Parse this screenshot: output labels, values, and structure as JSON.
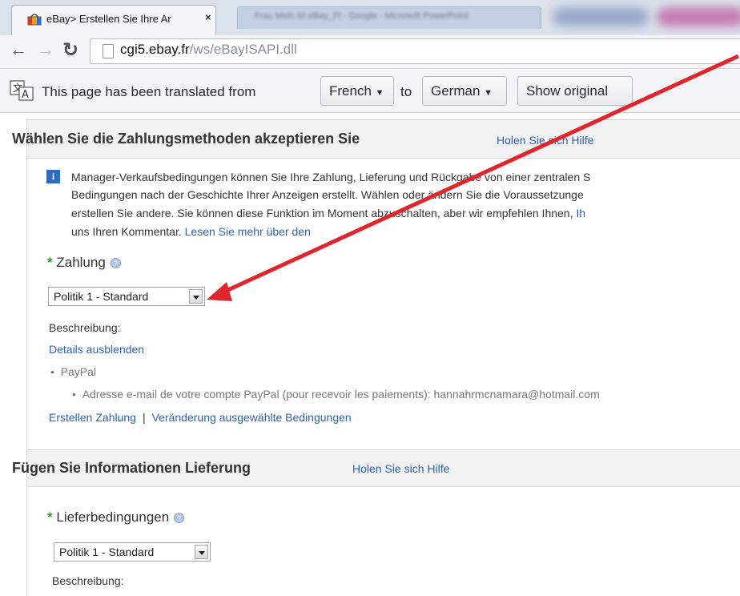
{
  "browser": {
    "active_tab_title": "eBay> Erstellen Sie Ihre Ar",
    "active_tab_close": "×",
    "inactive_tab_title": "Frau Mein ist eBay_Ft - Google - Microsoft PowerPoint",
    "url_host": "cgi5.ebay.fr",
    "url_path": "/ws/eBayISAPI.dll"
  },
  "translate_bar": {
    "message": "This page has been translated from",
    "from_language": "French",
    "to_label": "to",
    "to_language": "German",
    "show_original_label": "Show original"
  },
  "payment_section": {
    "title": "Wählen Sie die Zahlungsmethoden akzeptieren Sie",
    "help_link": "Holen Sie sich Hilfe",
    "info_icon_text": "i",
    "info_lines": [
      "Manager-Verkaufsbedingungen können Sie Ihre Zahlung, Lieferung und Rückgabe von einer zentralen S",
      "Bedingungen nach der Geschichte Ihrer Anzeigen erstellt. Wählen oder ändern Sie die Voraussetzunge",
      "erstellen Sie andere. Sie können diese Funktion im Moment abzuschalten, aber wir empfehlen Ihnen,",
      "uns Ihren Kommentar."
    ],
    "info_line3_tail": "Ih",
    "info_read_more": "Lesen Sie mehr über den",
    "required_star": "*",
    "field_label": "Zahlung",
    "help_dot": "?",
    "policy_value": "Politik 1 - Standard",
    "description_label": "Beschreibung:",
    "hide_details_link": "Details ausblenden",
    "bullet": "•",
    "method": "PayPal",
    "method_detail": "Adresse e-mail de votre compte PayPal (pour recevoir les paiements): hannahrmcnamara@hotmail.com",
    "create_link": "Erstellen Zahlung",
    "divider": "|",
    "change_link": "Veränderung ausgewählte Bedingungen"
  },
  "shipping_section": {
    "title": "Fügen Sie Informationen Lieferung",
    "help_link": "Holen Sie sich Hilfe",
    "required_star": "*",
    "field_label": "Lieferbedingungen",
    "help_dot": "?",
    "policy_value": "Politik 1 - Standard",
    "description_label": "Beschreibung:"
  },
  "colors": {
    "link": "#2b62b5",
    "required": "#3d9b26",
    "annotation_arrow": "#e0262c"
  },
  "icons": {
    "favicon": "shopping-bag-icon",
    "back": "arrow-left-icon",
    "forward": "arrow-right-icon",
    "reload": "reload-icon",
    "page": "page-icon",
    "translate": "translate-icon",
    "info": "info-icon",
    "help": "help-circle-icon"
  }
}
